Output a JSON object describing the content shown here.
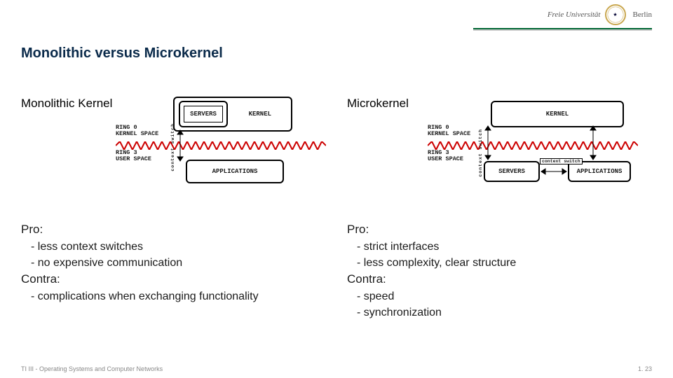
{
  "header": {
    "logo_left": "Freie Universität",
    "logo_right": "Berlin"
  },
  "title": "Monolithic versus Microkernel",
  "columns": {
    "left": {
      "heading": "Monolithic Kernel",
      "diagram": {
        "ring0_a": "RING 0",
        "ring0_b": "KERNEL SPACE",
        "ring3_a": "RING 3",
        "ring3_b": "USER SPACE",
        "servers": "SERVERS",
        "kernel": "KERNEL",
        "apps": "APPLICATIONS",
        "cs": "context switch"
      },
      "pro_label": "Pro:",
      "pro_items": [
        "- less context switches",
        "- no expensive communication"
      ],
      "contra_label": "Contra:",
      "contra_items": [
        "- complications when exchanging functionality"
      ]
    },
    "right": {
      "heading": "Microkernel",
      "diagram": {
        "ring0_a": "RING 0",
        "ring0_b": "KERNEL SPACE",
        "ring3_a": "RING 3",
        "ring3_b": "USER SPACE",
        "kernel": "KERNEL",
        "servers": "SERVERS",
        "apps": "APPLICATIONS",
        "cs": "context switch",
        "cs_h": "context switch"
      },
      "pro_label": "Pro:",
      "pro_items": [
        "- strict interfaces",
        "- less complexity, clear structure"
      ],
      "contra_label": "Contra:",
      "contra_items": [
        "- speed",
        "- synchronization"
      ]
    }
  },
  "footer": {
    "left": "TI III - Operating Systems and Computer Networks",
    "right": "1. 23"
  }
}
